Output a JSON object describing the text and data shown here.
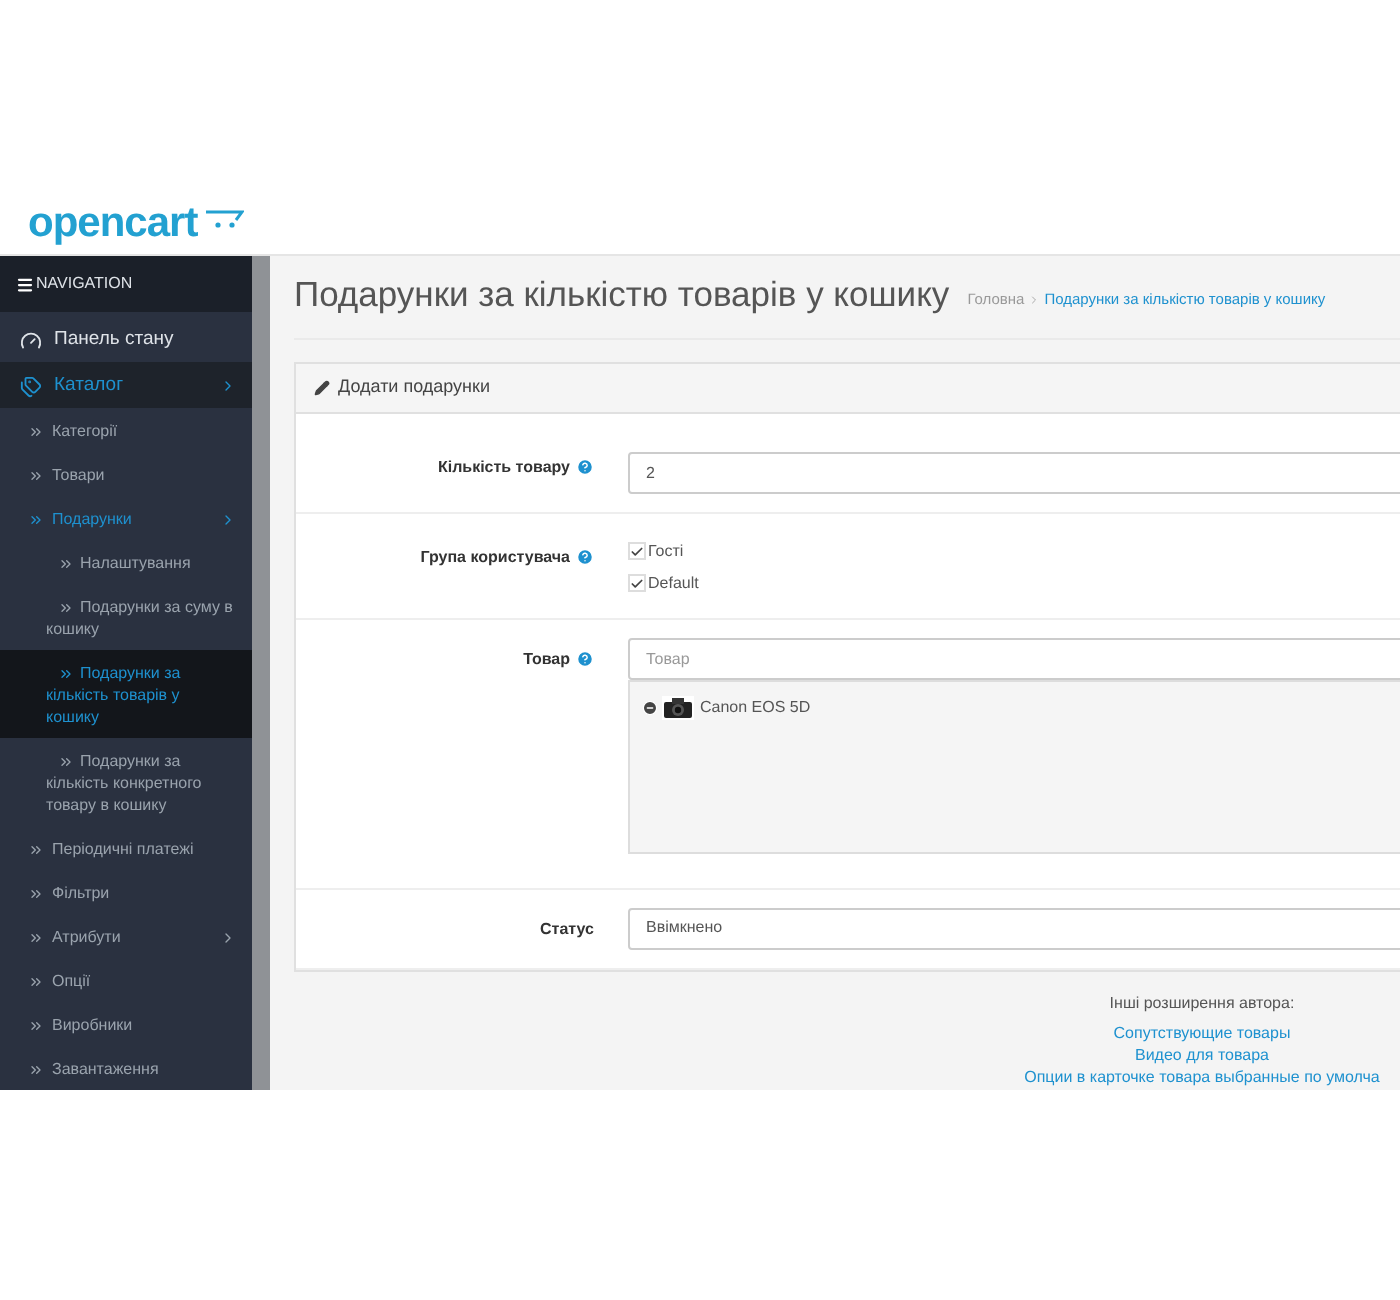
{
  "header": {
    "logo": "opencart"
  },
  "navigation": {
    "title": "NAVIGATION",
    "items": [
      {
        "label": "Панель стану",
        "expanded": false,
        "selected": false,
        "has_submenu": false
      },
      {
        "label": "Каталог",
        "expanded": true,
        "selected": false,
        "has_submenu": true,
        "children": [
          {
            "label": "Категорії",
            "expanded": false,
            "selected": false,
            "has_submenu": false
          },
          {
            "label": "Товари",
            "expanded": false,
            "selected": false,
            "has_submenu": false
          },
          {
            "label": "Подарунки",
            "expanded": true,
            "selected": false,
            "has_submenu": true,
            "children": [
              {
                "label": "Налаштування",
                "expanded": false,
                "selected": false,
                "has_submenu": false
              },
              {
                "label": "Подарунки за суму в кошику",
                "expanded": false,
                "selected": false,
                "has_submenu": false
              },
              {
                "label": "Подарунки за кількість товарів у кошику",
                "expanded": false,
                "selected": true,
                "has_submenu": false
              },
              {
                "label": "Подарунки за кількість конкретного товару в кошику",
                "expanded": false,
                "selected": false,
                "has_submenu": false
              }
            ]
          },
          {
            "label": "Періодичні платежі",
            "expanded": false,
            "selected": false,
            "has_submenu": false
          },
          {
            "label": "Фільтри",
            "expanded": false,
            "selected": false,
            "has_submenu": false
          },
          {
            "label": "Атрибути",
            "expanded": false,
            "selected": false,
            "has_submenu": true
          },
          {
            "label": "Опції",
            "expanded": false,
            "selected": false,
            "has_submenu": false
          },
          {
            "label": "Виробники",
            "expanded": false,
            "selected": false,
            "has_submenu": false
          },
          {
            "label": "Завантаження",
            "expanded": false,
            "selected": false,
            "has_submenu": false
          }
        ]
      }
    ]
  },
  "page": {
    "title": "Подарунки за кількістю товарів у кошику",
    "breadcrumbs": [
      "Головна",
      "Подарунки за кількістю товарів у кошику"
    ]
  },
  "panel": {
    "title": "Додати подарунки",
    "fields": [
      {
        "kind": "input",
        "label": "Кількість товару",
        "help": true,
        "value": "2"
      },
      {
        "kind": "checkboxes",
        "label": "Група користувача",
        "help": true,
        "options": [
          {
            "label": "Гості",
            "checked": true
          },
          {
            "label": "Default",
            "checked": true
          }
        ]
      },
      {
        "kind": "autocomplete",
        "label": "Товар",
        "help": true,
        "placeholder": "Товар",
        "items": [
          {
            "label": "Canon EOS 5D"
          }
        ]
      },
      {
        "kind": "select",
        "label": "Статус",
        "help": false,
        "value": "Ввімкнено"
      }
    ]
  },
  "footer": {
    "title": "Інші розширення автора:",
    "links": [
      "Сопутствующие товары",
      "Видео для товара",
      "Опции в карточке товара выбранные по умолча"
    ]
  }
}
